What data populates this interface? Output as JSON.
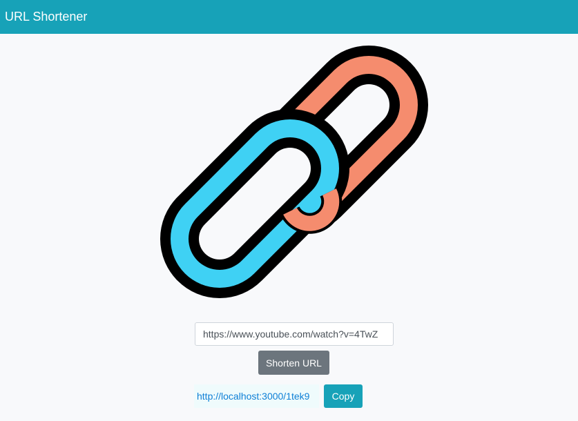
{
  "app": {
    "title": "URL Shortener"
  },
  "logo": {
    "icon": "chain-link-icon",
    "colors": {
      "front_link": "#3fd1f4",
      "back_link": "#f58c6e",
      "outline": "#000000"
    }
  },
  "form": {
    "url_value": "https://www.youtube.com/watch?v=4TwZ",
    "shorten_label": "Shorten URL"
  },
  "result": {
    "short_url": "http://localhost:3000/1tek9",
    "copy_label": "Copy"
  },
  "colors": {
    "navbar": "#17a2b8",
    "secondary_button": "#6c757d",
    "link": "#0d7fd6",
    "background": "#f8f9fb"
  }
}
